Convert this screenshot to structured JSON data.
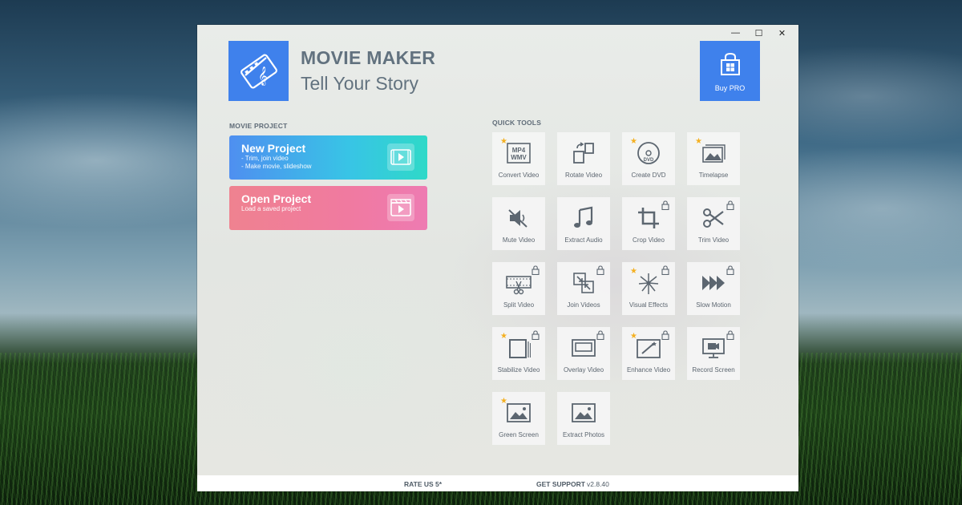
{
  "window": {
    "controls": {
      "minimize": "—",
      "maximize": "☐",
      "close": "✕"
    }
  },
  "header": {
    "logo_icon": "film-music-note-icon",
    "title": "MOVIE MAKER",
    "subtitle": "Tell Your Story",
    "buy_pro_label": "Buy PRO",
    "buy_pro_icon": "store-bag-icon"
  },
  "movie_project": {
    "section_label": "MOVIE PROJECT",
    "new_project": {
      "title": "New Project",
      "line1": "- Trim, join video",
      "line2": "- Make movie, slideshow"
    },
    "open_project": {
      "title": "Open Project",
      "line1": "Load a saved project"
    }
  },
  "quick_tools": {
    "section_label": "QUICK TOOLS",
    "items": [
      {
        "label": "Convert Video",
        "icon": "mp4-wmv-icon",
        "star": true,
        "locked": false
      },
      {
        "label": "Rotate Video",
        "icon": "rotate-icon",
        "star": false,
        "locked": false
      },
      {
        "label": "Create DVD",
        "icon": "dvd-icon",
        "star": true,
        "locked": false
      },
      {
        "label": "Timelapse",
        "icon": "photo-stack-icon",
        "star": true,
        "locked": false
      },
      {
        "label": "Mute Video",
        "icon": "mute-speaker-icon",
        "star": false,
        "locked": false
      },
      {
        "label": "Extract Audio",
        "icon": "music-note-icon",
        "star": false,
        "locked": false
      },
      {
        "label": "Crop Video",
        "icon": "crop-icon",
        "star": false,
        "locked": true
      },
      {
        "label": "Trim Video",
        "icon": "scissors-icon",
        "star": false,
        "locked": true
      },
      {
        "label": "Split Video",
        "icon": "film-scissors-icon",
        "star": false,
        "locked": true
      },
      {
        "label": "Join Videos",
        "icon": "join-arrows-icon",
        "star": false,
        "locked": true
      },
      {
        "label": "Visual Effects",
        "icon": "fireworks-icon",
        "star": true,
        "locked": true
      },
      {
        "label": "Slow Motion",
        "icon": "fast-forward-icon",
        "star": false,
        "locked": true
      },
      {
        "label": "Stabilize Video",
        "icon": "stabilize-icon",
        "star": true,
        "locked": true
      },
      {
        "label": "Overlay Video",
        "icon": "overlay-icon",
        "star": false,
        "locked": true
      },
      {
        "label": "Enhance Video",
        "icon": "magic-wand-icon",
        "star": true,
        "locked": true
      },
      {
        "label": "Record Screen",
        "icon": "monitor-camera-icon",
        "star": false,
        "locked": true
      },
      {
        "label": "Green Screen",
        "icon": "image-landscape-icon",
        "star": true,
        "locked": false
      },
      {
        "label": "Extract Photos",
        "icon": "photo-icon",
        "star": false,
        "locked": false
      }
    ]
  },
  "footer": {
    "rate_us": "RATE US 5*",
    "get_support": "GET SUPPORT",
    "version": "v2.8.40"
  },
  "colors": {
    "accent_blue": "#3f81ec",
    "new_project_gradient": [
      "#4f8ff0",
      "#2fd9c8"
    ],
    "open_project_gradient": [
      "#ef8290",
      "#ee7bb2"
    ],
    "star": "#f4b021",
    "icon_gray": "#5c6670"
  }
}
